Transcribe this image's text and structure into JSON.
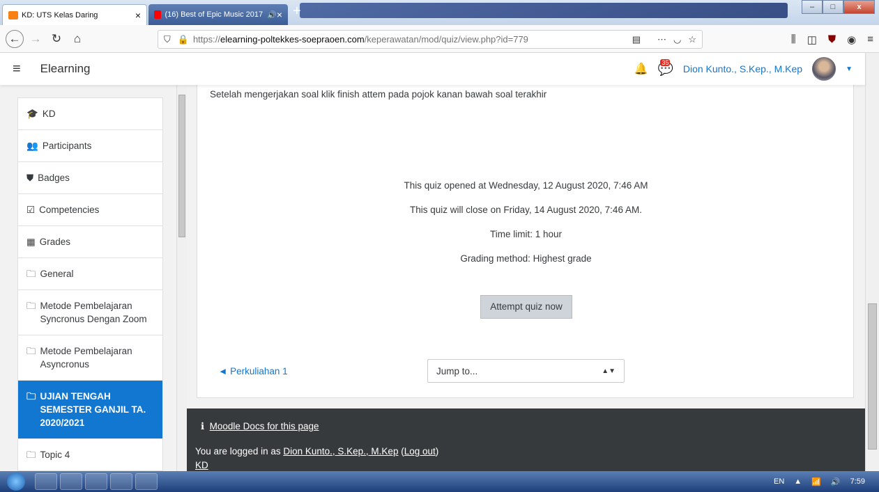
{
  "browser": {
    "tabs": [
      {
        "label": "KD: UTS Kelas Daring",
        "favicon_color": "#f98012"
      },
      {
        "label": "(16) Best of Epic Music 2017",
        "favicon_color": "#ff0000"
      }
    ],
    "close_glyph": "×",
    "new_tab_glyph": "+",
    "window_controls": {
      "minimize": "–",
      "maximize": "□",
      "close": "x"
    },
    "url": {
      "prefix": "https://",
      "domain": "elearning-poltekkes-soepraoen.com",
      "path": "/keperawatan/mod/quiz/view.php?id=779"
    }
  },
  "moodle": {
    "brand": "Elearning",
    "notification_count": "35",
    "user_name": "Dion Kunto., S.Kep., M.Kep",
    "drawer": [
      {
        "label": "KD",
        "icon": "graduation-cap-icon",
        "glyph": "🎓"
      },
      {
        "label": "Participants",
        "icon": "users-icon",
        "glyph": "👥"
      },
      {
        "label": "Badges",
        "icon": "shield-icon",
        "glyph": "⛊"
      },
      {
        "label": "Competencies",
        "icon": "check-square-icon",
        "glyph": "☑"
      },
      {
        "label": "Grades",
        "icon": "table-icon",
        "glyph": "▦"
      },
      {
        "label": "General",
        "icon": "folder-icon",
        "glyph": "🗀"
      },
      {
        "label": "Metode Pembelajaran Syncronus Dengan Zoom",
        "icon": "folder-icon",
        "glyph": "🗀"
      },
      {
        "label": "Metode Pembelajaran Asyncronus",
        "icon": "folder-icon",
        "glyph": "🗀"
      },
      {
        "label": "UJIAN TENGAH SEMESTER GANJIL TA. 2020/2021",
        "icon": "folder-icon",
        "glyph": "🗀",
        "active": true
      },
      {
        "label": "Topic 4",
        "icon": "folder-icon",
        "glyph": "🗀"
      }
    ]
  },
  "quiz": {
    "instruction": "Setelah mengerjakan soal klik finish attem pada pojok kanan bawah soal terakhir",
    "opened": "This quiz opened at Wednesday, 12 August 2020, 7:46 AM",
    "closes": "This quiz will close on Friday, 14 August 2020, 7:46 AM.",
    "time_limit": "Time limit: 1 hour",
    "grading": "Grading method: Highest grade",
    "attempt_button": "Attempt quiz now",
    "prev_activity": "◄ Perkuliahan 1",
    "jump_placeholder": "Jump to..."
  },
  "footer": {
    "docs_link": "Moodle Docs for this page",
    "logged_prefix": "You are logged in as ",
    "logged_user": "Dion Kunto., S.Kep., M.Kep",
    "logout_open": " (",
    "logout": "Log out",
    "logout_close": ")",
    "course": "KD"
  },
  "taskbar": {
    "lang": "EN",
    "time": "7:59"
  }
}
